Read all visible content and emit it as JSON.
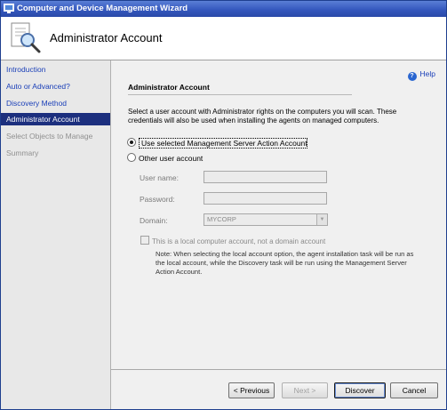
{
  "window": {
    "title": "Computer and Device Management Wizard"
  },
  "header": {
    "title": "Administrator Account"
  },
  "sidebar": {
    "items": [
      {
        "label": "Introduction",
        "state": "link"
      },
      {
        "label": "Auto or Advanced?",
        "state": "link"
      },
      {
        "label": "Discovery Method",
        "state": "link"
      },
      {
        "label": "Administrator Account",
        "state": "active"
      },
      {
        "label": "Select Objects to Manage",
        "state": "disabled"
      },
      {
        "label": "Summary",
        "state": "disabled"
      }
    ]
  },
  "content": {
    "help_label": "Help",
    "section_title": "Administrator Account",
    "description": "Select a user account with Administrator rights on the computers you will scan. These credentials will also be used when installing the agents on managed computers.",
    "option_action_account": {
      "label": "Use selected Management Server Action Account",
      "checked": true
    },
    "option_other_account": {
      "label": "Other user account",
      "checked": false
    },
    "fields": {
      "username_label": "User name:",
      "username_value": "",
      "password_label": "Password:",
      "password_value": "",
      "domain_label": "Domain:",
      "domain_value": "MYCORP"
    },
    "local_account_checkbox": {
      "label": "This is a local computer account, not a domain account",
      "checked": false
    },
    "note": "Note:  When selecting the local account option, the agent installation task will be run as the local account, while the Discovery task will be run using the Management Server Action Account."
  },
  "buttons": {
    "previous": "< Previous",
    "next": "Next >",
    "discover": "Discover",
    "cancel": "Cancel"
  },
  "colors": {
    "titlebar": "#3558be",
    "nav_active_bg": "#1c2f7e",
    "link": "#1a3fb8"
  }
}
